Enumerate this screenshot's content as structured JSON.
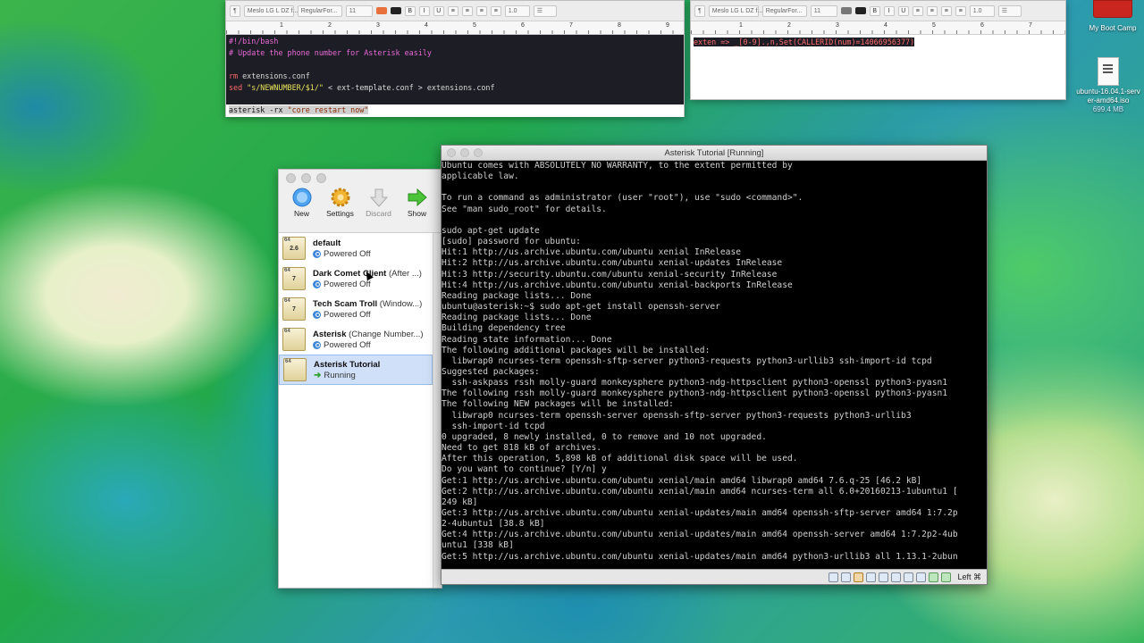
{
  "editor_left": {
    "toolbar": {
      "paragraph_symbol": "¶",
      "font_family": "Meslo LG L DZ f...",
      "font_style": "RegularFor...",
      "font_size": "11",
      "spacing": "1.0",
      "bold": "B",
      "italic": "I",
      "underline": "U"
    },
    "ruler": [
      "1",
      "2",
      "3",
      "4",
      "5",
      "6",
      "7",
      "8",
      "9"
    ],
    "lines": {
      "l1": "#!/bin/bash",
      "l2": "# Update the phone number for Asterisk easily",
      "l3": "",
      "l4_cmd": "rm",
      "l4_rest": " extensions.conf",
      "l5_cmd": "sed",
      "l5_str": " \"s/NEWNUMBER/$1/\"",
      "l5_rest": " < ext-template.conf > extensions.conf",
      "l6_cmd": "asterisk",
      "l6_mid": " -rx ",
      "l6_str": "\"core restart now\""
    }
  },
  "editor_right": {
    "toolbar": {
      "paragraph_symbol": "¶",
      "font_family": "Meslo LG L DZ f...",
      "font_style": "RegularFor...",
      "font_size": "11",
      "spacing": "1.0",
      "bold": "B",
      "italic": "I",
      "underline": "U"
    },
    "ruler": [
      "1",
      "2",
      "3",
      "4",
      "5",
      "6",
      "7"
    ],
    "line1": "exten => _[0-9].,n,Set(CALLERID(num)=14066956377)"
  },
  "vbox": {
    "toolbar": [
      {
        "label": "New",
        "icon": "new-icon"
      },
      {
        "label": "Settings",
        "icon": "settings-gear-icon"
      },
      {
        "label": "Discard",
        "icon": "discard-arrow-icon"
      },
      {
        "label": "Show",
        "icon": "show-arrow-icon"
      }
    ],
    "vms": [
      {
        "name": "default",
        "sub": "",
        "state": "Powered Off",
        "badge": "2.6"
      },
      {
        "name": "Dark Comet Client",
        "sub": " (After ...)",
        "state": "Powered Off",
        "badge": "7"
      },
      {
        "name": "Tech Scam Troll",
        "sub": " (Window...)",
        "state": "Powered Off",
        "badge": "7"
      },
      {
        "name": "Asterisk",
        "sub": " (Change Number...)",
        "state": "Powered Off",
        "badge": ""
      },
      {
        "name": "Asterisk Tutorial",
        "sub": "",
        "state": "Running",
        "badge": ""
      }
    ]
  },
  "vm_window": {
    "title": "Asterisk Tutorial [Running]",
    "console": "Ubuntu comes with ABSOLUTELY NO WARRANTY, to the extent permitted by\napplicable law.\n\nTo run a command as administrator (user \"root\"), use \"sudo <command>\".\nSee \"man sudo_root\" for details.\n\nsudo apt-get update\n[sudo] password for ubuntu:\nHit:1 http://us.archive.ubuntu.com/ubuntu xenial InRelease\nHit:2 http://us.archive.ubuntu.com/ubuntu xenial-updates InRelease\nHit:3 http://security.ubuntu.com/ubuntu xenial-security InRelease\nHit:4 http://us.archive.ubuntu.com/ubuntu xenial-backports InRelease\nReading package lists... Done\nubuntu@asterisk:~$ sudo apt-get install openssh-server\nReading package lists... Done\nBuilding dependency tree\nReading state information... Done\nThe following additional packages will be installed:\n  libwrap0 ncurses-term openssh-sftp-server python3-requests python3-urllib3 ssh-import-id tcpd\nSuggested packages:\n  ssh-askpass rssh molly-guard monkeysphere python3-ndg-httpsclient python3-openssl python3-pyasn1\nThe following rssh molly-guard monkeysphere python3-ndg-httpsclient python3-openssl python3-pyasn1\nThe following NEW packages will be installed:\n  libwrap0 ncurses-term openssh-server openssh-sftp-server python3-requests python3-urllib3\n  ssh-import-id tcpd\n0 upgraded, 8 newly installed, 0 to remove and 10 not upgraded.\nNeed to get 818 kB of archives.\nAfter this operation, 5,898 kB of additional disk space will be used.\nDo you want to continue? [Y/n] y\nGet:1 http://us.archive.ubuntu.com/ubuntu xenial/main amd64 libwrap0 amd64 7.6.q-25 [46.2 kB]\nGet:2 http://us.archive.ubuntu.com/ubuntu xenial/main amd64 ncurses-term all 6.0+20160213-1ubuntu1 [\n249 kB]\nGet:3 http://us.archive.ubuntu.com/ubuntu xenial-updates/main amd64 openssh-sftp-server amd64 1:7.2p\n2-4ubuntu1 [38.8 kB]\nGet:4 http://us.archive.ubuntu.com/ubuntu xenial-updates/main amd64 openssh-server amd64 1:7.2p2-4ub\nuntu1 [338 kB]\nGet:5 http://us.archive.ubuntu.com/ubuntu xenial-updates/main amd64 python3-urllib3 all 1.13.1-2ubun",
    "host_key": "Left ⌘"
  },
  "desktop": {
    "icons": [
      {
        "label": "My Boot Camp"
      },
      {
        "label": "ubuntu-16.04.1-server-amd64.iso",
        "size": "699.4 MB"
      }
    ]
  }
}
